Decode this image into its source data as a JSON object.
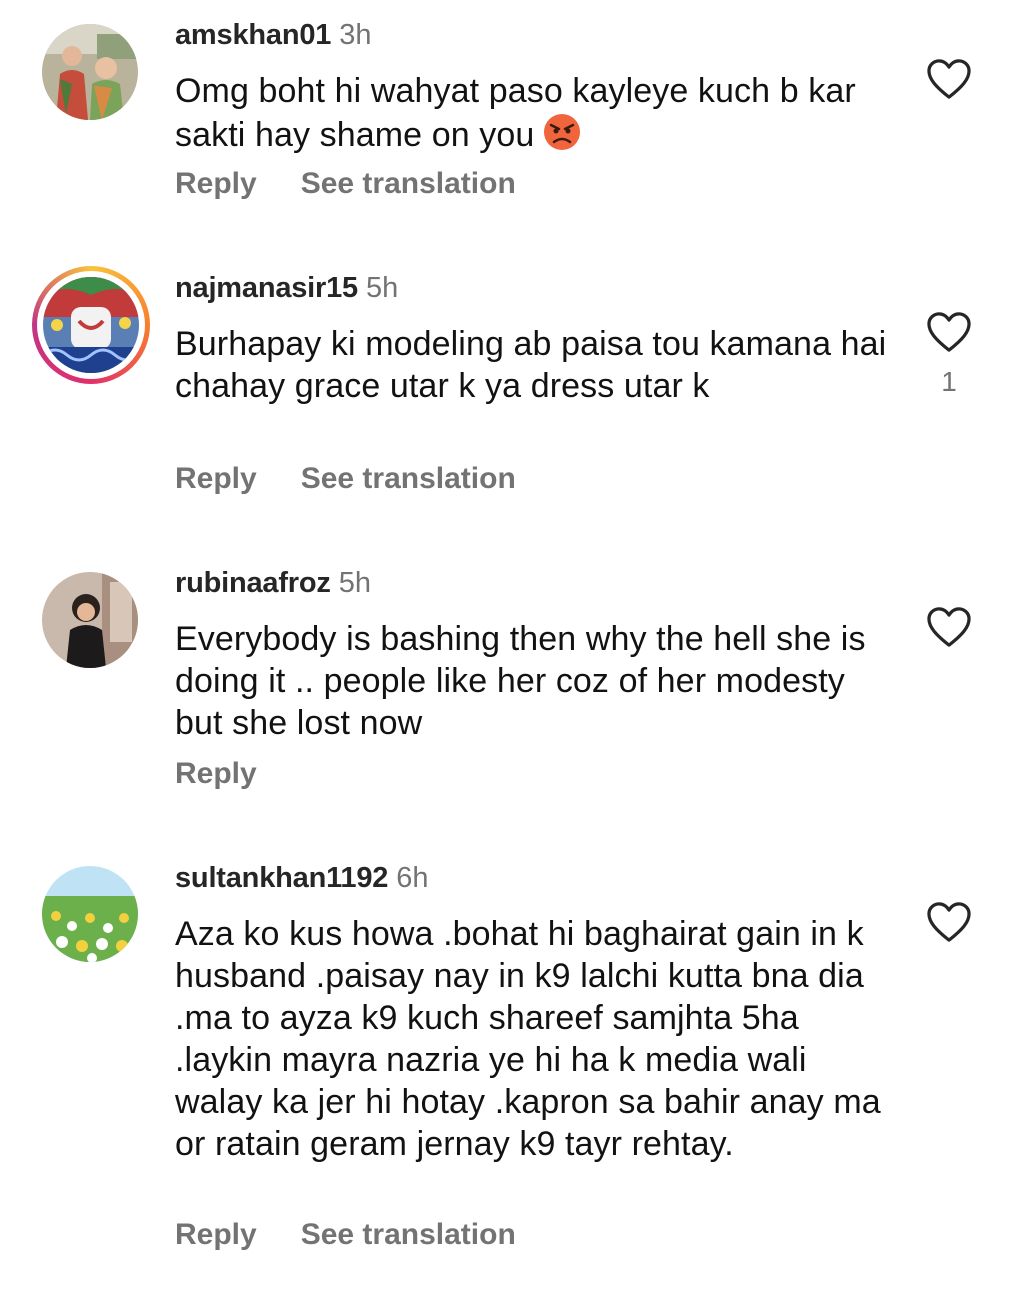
{
  "comments": [
    {
      "username": "amskhan01",
      "time": "3h",
      "text": "Omg boht hi wahyat paso kayleye kuch b kar sakti hay shame on you",
      "reply_label": "Reply",
      "translate_label": "See translation",
      "like_count": "",
      "emoji": "angry-face"
    },
    {
      "username": "najmanasir15",
      "time": "5h",
      "text": "Burhapay ki modeling ab paisa tou kamana hai chahay grace utar k ya dress utar k",
      "reply_label": "Reply",
      "translate_label": "See translation",
      "like_count": "1"
    },
    {
      "username": "rubinaafroz",
      "time": "5h",
      "text": "Everybody is bashing then why the hell she is doing it .. people like her coz of her modesty but she lost now",
      "reply_label": "Reply",
      "like_count": ""
    },
    {
      "username": "sultankhan1192",
      "time": "6h",
      "text": "Aza ko kus howa .bohat hi baghairat gain in k husband .paisay nay in k9 lalchi kutta bna dia .ma to ayza k9 kuch shareef samjhta 5ha .laykin mayra nazria ye hi ha k media wali walay ka jer hi hotay .kapron sa bahir anay ma or ratain geram jernay k9 tayr rehtay.",
      "reply_label": "Reply",
      "translate_label": "See translation",
      "like_count": ""
    }
  ],
  "icons": {
    "like": "heart-outline-icon",
    "angry": "angry-face-emoji"
  },
  "colors": {
    "secondary_text": "#737373",
    "username": "#262626",
    "story_ring": [
      "#f9c33b",
      "#f77f2f",
      "#e1306c",
      "#c13584"
    ]
  }
}
